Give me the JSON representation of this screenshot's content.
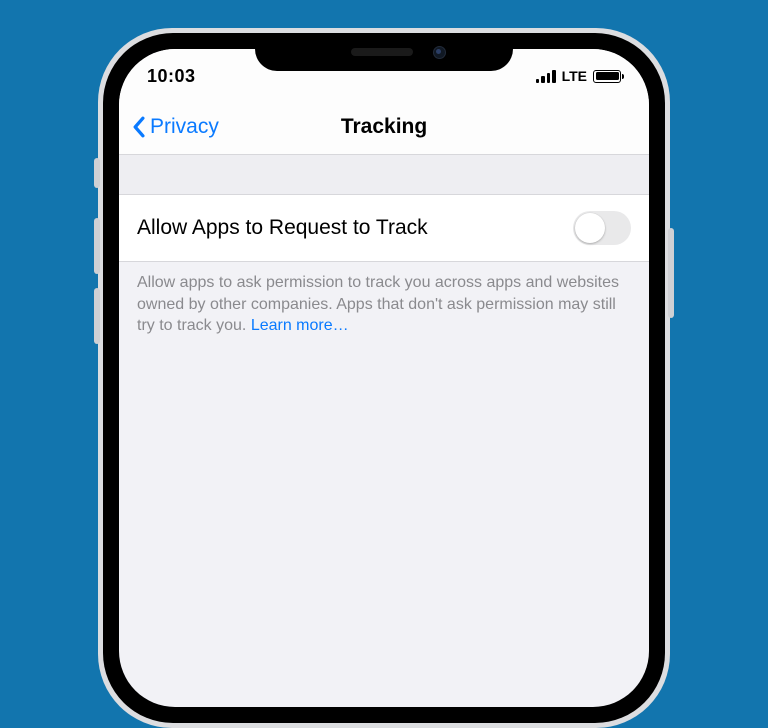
{
  "status_bar": {
    "time": "10:03",
    "network_label": "LTE"
  },
  "nav": {
    "back_label": "Privacy",
    "title": "Tracking"
  },
  "setting": {
    "label": "Allow Apps to Request to Track",
    "enabled": false
  },
  "footer": {
    "text": "Allow apps to ask permission to track you across apps and websites owned by other companies. Apps that don't ask permission may still try to track you. ",
    "link_text": "Learn more…"
  },
  "colors": {
    "background": "#1275ae",
    "ios_blue": "#0a7aff",
    "secondary_text": "#8a8a8e"
  }
}
